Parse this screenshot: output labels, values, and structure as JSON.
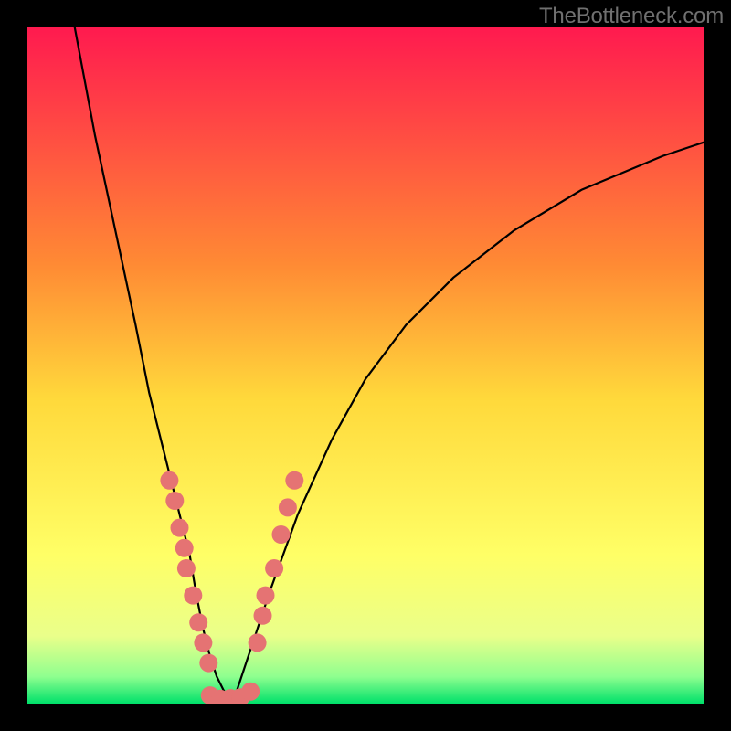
{
  "attribution": "TheBottleneck.com",
  "chart_data": {
    "type": "line",
    "title": "",
    "xlabel": "",
    "ylabel": "",
    "xlim": [
      0,
      100
    ],
    "ylim": [
      0,
      100
    ],
    "gradient_stops": [
      {
        "offset": 0,
        "color": "#ff1a4f"
      },
      {
        "offset": 35,
        "color": "#ff8a34"
      },
      {
        "offset": 55,
        "color": "#ffd93b"
      },
      {
        "offset": 78,
        "color": "#ffff66"
      },
      {
        "offset": 90,
        "color": "#eaff8a"
      },
      {
        "offset": 96,
        "color": "#8fff8f"
      },
      {
        "offset": 100,
        "color": "#00e06a"
      }
    ],
    "series": [
      {
        "name": "curve-left",
        "x": [
          7,
          10,
          13,
          16,
          18,
          20,
          22,
          24,
          25,
          26,
          27,
          28,
          29,
          30
        ],
        "y": [
          100,
          84,
          70,
          56,
          46,
          38,
          30,
          22,
          16,
          11,
          7,
          4,
          2,
          0.5
        ]
      },
      {
        "name": "curve-right",
        "x": [
          30,
          31,
          33,
          36,
          40,
          45,
          50,
          56,
          63,
          72,
          82,
          94,
          100
        ],
        "y": [
          0.5,
          2,
          8,
          17,
          28,
          39,
          48,
          56,
          63,
          70,
          76,
          81,
          83
        ]
      },
      {
        "name": "valley-floor",
        "x": [
          26,
          28,
          30,
          32,
          33
        ],
        "y": [
          1.2,
          0.6,
          0.5,
          0.7,
          1.5
        ]
      }
    ],
    "markers": {
      "left_cluster": [
        {
          "x": 21.0,
          "y": 33
        },
        {
          "x": 21.8,
          "y": 30
        },
        {
          "x": 22.5,
          "y": 26
        },
        {
          "x": 23.2,
          "y": 23
        },
        {
          "x": 23.5,
          "y": 20
        },
        {
          "x": 24.5,
          "y": 16
        },
        {
          "x": 25.3,
          "y": 12
        },
        {
          "x": 26.0,
          "y": 9
        },
        {
          "x": 26.8,
          "y": 6
        }
      ],
      "right_cluster": [
        {
          "x": 34.0,
          "y": 9
        },
        {
          "x": 34.8,
          "y": 13
        },
        {
          "x": 35.2,
          "y": 16
        },
        {
          "x": 36.5,
          "y": 20
        },
        {
          "x": 37.5,
          "y": 25
        },
        {
          "x": 38.5,
          "y": 29
        },
        {
          "x": 39.5,
          "y": 33
        }
      ],
      "bottom_cluster": [
        {
          "x": 27.0,
          "y": 1.2
        },
        {
          "x": 28.5,
          "y": 0.7
        },
        {
          "x": 30.0,
          "y": 0.8
        },
        {
          "x": 31.5,
          "y": 0.9
        },
        {
          "x": 33.0,
          "y": 1.8
        }
      ]
    },
    "marker_style": {
      "r": 10,
      "fill": "#e57373",
      "stroke": "#e57373"
    },
    "curve_style": {
      "stroke": "#000000",
      "width": 2.2
    }
  }
}
